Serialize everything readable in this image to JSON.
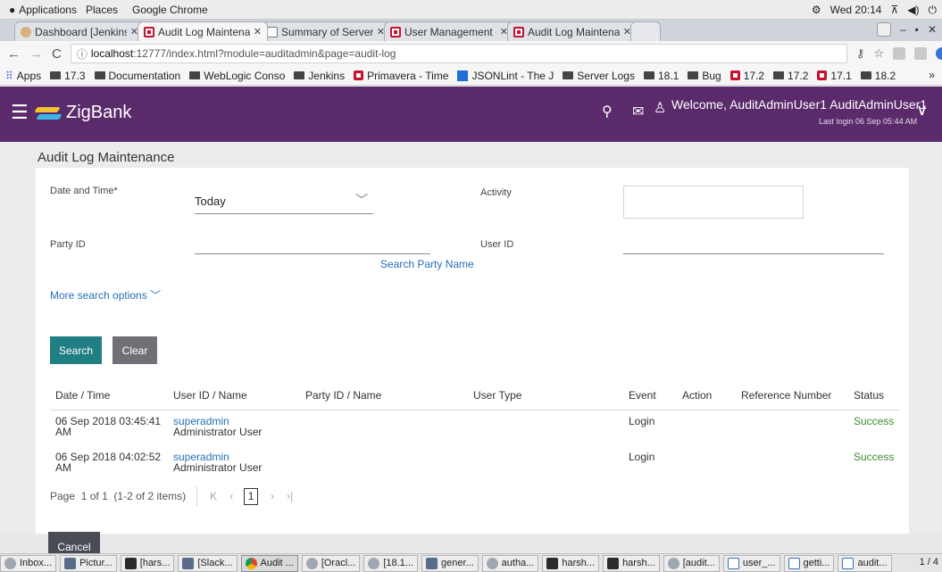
{
  "os": {
    "applications": "Applications",
    "places": "Places",
    "app_name": "Google Chrome",
    "clock": "Wed 20:14"
  },
  "browser": {
    "tabs": [
      {
        "label": "Dashboard [Jenkins]",
        "icon": "jenkins-icon"
      },
      {
        "label": "Audit Log Maintenan",
        "icon": "oracle-icon",
        "active": true
      },
      {
        "label": "Summary of Servers",
        "icon": "document-icon"
      },
      {
        "label": "User Management -",
        "icon": "oracle-icon"
      },
      {
        "label": "Audit Log Maintenan",
        "icon": "oracle-icon"
      }
    ],
    "url_host": "localhost",
    "url_rest": ":12777/index.html?module=auditadmin&page=audit-log",
    "bookmarks": [
      "Apps",
      "17.3",
      "Documentation",
      "WebLogic Conso",
      "Jenkins",
      "Primavera - Time",
      "JSONLint - The J",
      "Server Logs",
      "18.1",
      "Bug",
      "17.2",
      "17.2",
      "17.1",
      "18.2"
    ]
  },
  "header": {
    "brand": "ZigBank",
    "welcome": "Welcome, AuditAdminUser1 AuditAdminUser1",
    "last_login": "Last login 06 Sep 05:44 AM"
  },
  "page": {
    "title": "Audit Log Maintenance",
    "form": {
      "date_label": "Date and Time*",
      "date_value": "Today",
      "activity_label": "Activity",
      "party_label": "Party ID",
      "user_label": "User ID",
      "search_party_link": "Search Party Name",
      "more_options": "More search options"
    },
    "buttons": {
      "search": "Search",
      "clear": "Clear",
      "cancel": "Cancel"
    },
    "table": {
      "columns": [
        "Date / Time",
        "User ID / Name",
        "Party ID / Name",
        "User Type",
        "Event",
        "Action",
        "Reference Number",
        "Status"
      ],
      "rows": [
        {
          "date_line1": "06 Sep 2018 03:45:41",
          "date_line2": "AM",
          "user_id": "superadmin",
          "user_name": "Administrator User",
          "event": "Login",
          "status": "Success"
        },
        {
          "date_line1": "06 Sep 2018 04:02:52",
          "date_line2": "AM",
          "user_id": "superadmin",
          "user_name": "Administrator User",
          "event": "Login",
          "status": "Success"
        }
      ]
    },
    "pager": {
      "page_word": "Page",
      "current": "1",
      "of_total": "of 1",
      "items": "(1-2 of 2 items)"
    }
  },
  "taskbar": {
    "items": [
      "Inbox...",
      "Pictur...",
      "[hars...",
      "[Slack...",
      "Audit ...",
      "[Oracl...",
      "[18.1...",
      "gener...",
      "autha...",
      "harsh...",
      "harsh...",
      "[audit...",
      "user_...",
      "getti...",
      "audit..."
    ],
    "page_count": "1 / 4"
  },
  "colors": {
    "header_bg": "#5a2a6b",
    "primary_button": "#1f7f83",
    "secondary_button": "#6f7177",
    "link": "#2670b8",
    "success": "#3d8b2f"
  }
}
